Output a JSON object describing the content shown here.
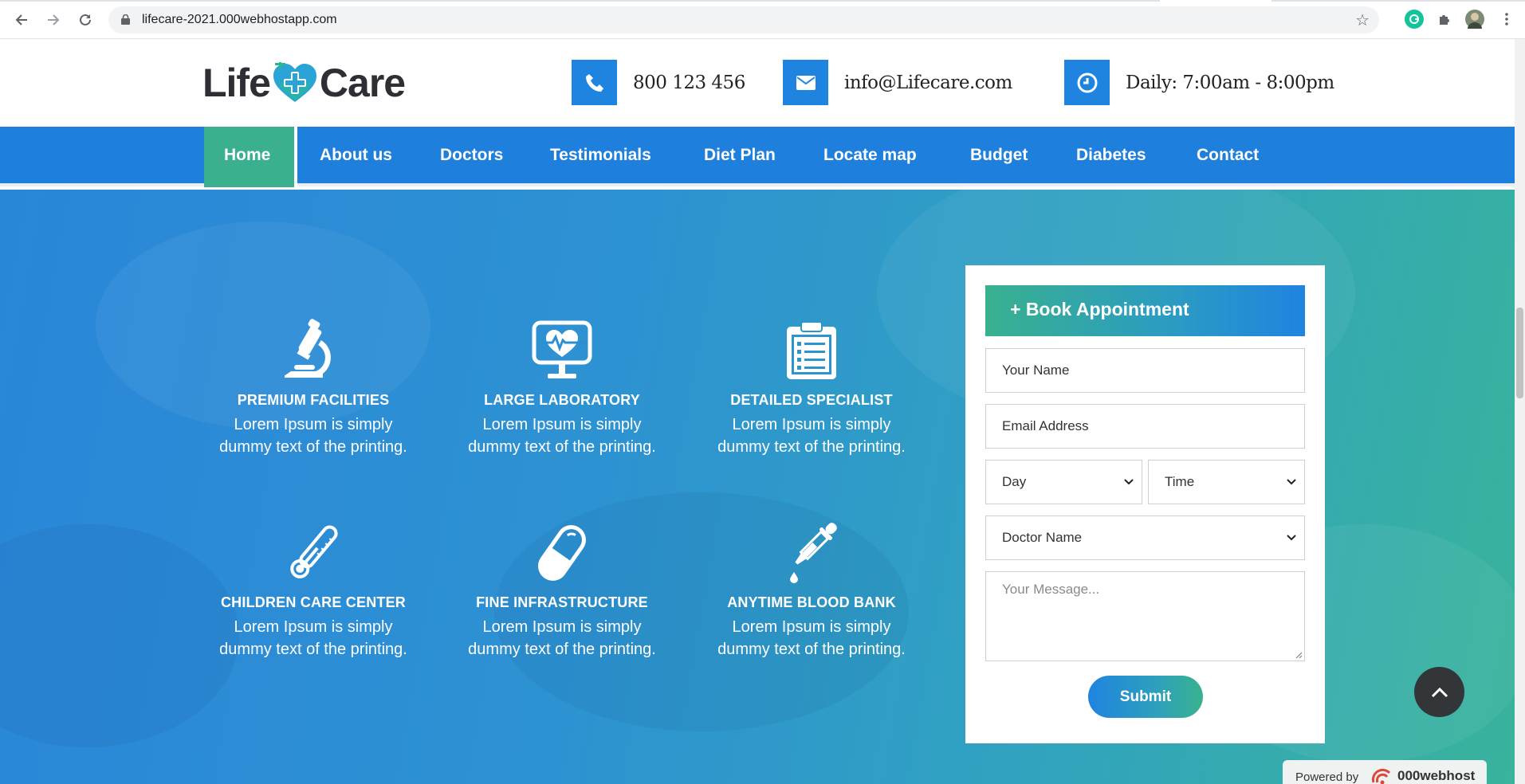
{
  "browser": {
    "url": "lifecare-2021.000webhostapp.com",
    "back_icon": "arrow-left-icon",
    "forward_icon": "arrow-right-icon",
    "reload_icon": "reload-icon"
  },
  "header": {
    "logo_left": "Life",
    "logo_right": "Care",
    "phone": "800 123 456",
    "email": "info@Lifecare.com",
    "hours": "Daily: 7:00am - 8:00pm"
  },
  "nav": {
    "items": [
      "Home",
      "About us",
      "Doctors",
      "Testimonials",
      "Diet Plan",
      "Locate map",
      "Budget",
      "Diabetes",
      "Contact"
    ],
    "active": "Home"
  },
  "features": [
    {
      "icon": "microscope-icon",
      "title": "PREMIUM FACILITIES",
      "line1": "Lorem Ipsum is simply",
      "line2": "dummy text of the printing."
    },
    {
      "icon": "monitor-heart-icon",
      "title": "LARGE LABORATORY",
      "line1": "Lorem Ipsum is simply",
      "line2": "dummy text of the printing."
    },
    {
      "icon": "clipboard-icon",
      "title": "DETAILED SPECIALIST",
      "line1": "Lorem Ipsum is simply",
      "line2": "dummy text of the printing."
    },
    {
      "icon": "thermometer-icon",
      "title": "CHILDREN CARE CENTER",
      "line1": "Lorem Ipsum is simply",
      "line2": "dummy text of the printing."
    },
    {
      "icon": "pill-icon",
      "title": "FINE INFRASTRUCTURE",
      "line1": "Lorem Ipsum is simply",
      "line2": "dummy text of the printing."
    },
    {
      "icon": "dropper-icon",
      "title": "ANYTIME BLOOD BANK",
      "line1": "Lorem Ipsum is simply",
      "line2": "dummy text of the printing."
    }
  ],
  "form": {
    "title": "+ Book Appointment",
    "name_placeholder": "Your Name",
    "email_placeholder": "Email Address",
    "day_selected": "Day",
    "time_selected": "Time",
    "doctor_selected": "Doctor Name",
    "message_placeholder": "Your Message...",
    "submit_label": "Submit"
  },
  "footer": {
    "powered_by": "Powered by",
    "host": "000webhost"
  },
  "colors": {
    "primary_blue": "#1f7fdc",
    "accent_green": "#3ab08f"
  }
}
